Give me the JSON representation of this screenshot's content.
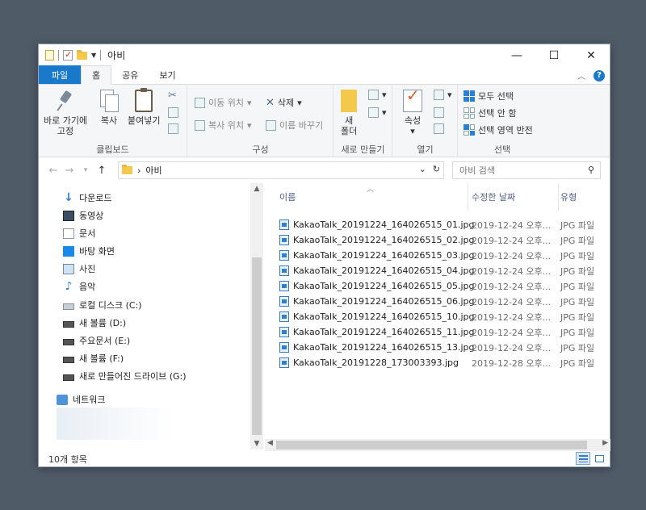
{
  "window": {
    "title": "아비",
    "controls": {
      "minimize": "—",
      "maximize": "☐",
      "close": "✕"
    }
  },
  "tabs": [
    {
      "label": "파일"
    },
    {
      "label": "홈"
    },
    {
      "label": "공유"
    },
    {
      "label": "보기"
    }
  ],
  "ribbon": {
    "clipboard": {
      "label": "클립보드",
      "pin": "바로 가기에\n고정",
      "pin_line1": "바로 가기에",
      "pin_line2": "고정",
      "copy": "복사",
      "paste": "붙여넣기"
    },
    "organize": {
      "label": "구성",
      "move_to": "이동 위치",
      "copy_to": "복사 위치",
      "delete": "삭제",
      "rename": "이름 바꾸기"
    },
    "new": {
      "label": "새로 만들기",
      "new_folder_line1": "새",
      "new_folder_line2": "폴더"
    },
    "open": {
      "label": "열기",
      "properties": "속성"
    },
    "select": {
      "label": "선택",
      "select_all": "모두 선택",
      "select_none": "선택 안 함",
      "invert": "선택 영역 반전"
    }
  },
  "address": {
    "path": "아비",
    "search_placeholder": "아비 검색"
  },
  "nav": {
    "items": [
      {
        "label": "다운로드",
        "icon": "download-icon"
      },
      {
        "label": "동영상",
        "icon": "video-icon"
      },
      {
        "label": "문서",
        "icon": "document-icon"
      },
      {
        "label": "바탕 화면",
        "icon": "desktop-icon"
      },
      {
        "label": "사진",
        "icon": "pictures-icon"
      },
      {
        "label": "음악",
        "icon": "music-icon"
      },
      {
        "label": "로컬 디스크 (C:)",
        "icon": "drive-icon"
      },
      {
        "label": "새 볼륨 (D:)",
        "icon": "drive-icon"
      },
      {
        "label": "주요문서 (E:)",
        "icon": "drive-icon"
      },
      {
        "label": "새 볼륨 (F:)",
        "icon": "drive-icon"
      },
      {
        "label": "새로 만들어진 드라이브 (G:)",
        "icon": "drive-icon"
      },
      {
        "label": "네트워크",
        "icon": "network-icon"
      }
    ]
  },
  "files": {
    "columns": {
      "name": "이름",
      "date": "수정한 날짜",
      "type": "유형"
    },
    "rows": [
      {
        "name": "KakaoTalk_20191224_164026515_01.jpg",
        "date": "2019-12-24 오후...",
        "type": "JPG 파일"
      },
      {
        "name": "KakaoTalk_20191224_164026515_02.jpg",
        "date": "2019-12-24 오후...",
        "type": "JPG 파일"
      },
      {
        "name": "KakaoTalk_20191224_164026515_03.jpg",
        "date": "2019-12-24 오후...",
        "type": "JPG 파일"
      },
      {
        "name": "KakaoTalk_20191224_164026515_04.jpg",
        "date": "2019-12-24 오후...",
        "type": "JPG 파일"
      },
      {
        "name": "KakaoTalk_20191224_164026515_05.jpg",
        "date": "2019-12-24 오후...",
        "type": "JPG 파일"
      },
      {
        "name": "KakaoTalk_20191224_164026515_06.jpg",
        "date": "2019-12-24 오후...",
        "type": "JPG 파일"
      },
      {
        "name": "KakaoTalk_20191224_164026515_10.jpg",
        "date": "2019-12-24 오후...",
        "type": "JPG 파일"
      },
      {
        "name": "KakaoTalk_20191224_164026515_11.jpg",
        "date": "2019-12-24 오후...",
        "type": "JPG 파일"
      },
      {
        "name": "KakaoTalk_20191224_164026515_13.jpg",
        "date": "2019-12-24 오후...",
        "type": "JPG 파일"
      },
      {
        "name": "KakaoTalk_20191228_173003393.jpg",
        "date": "2019-12-28 오후...",
        "type": "JPG 파일"
      }
    ]
  },
  "status": {
    "count": "10개 항목"
  },
  "colors": {
    "accent": "#1979ca",
    "header_text": "#4d6082"
  }
}
